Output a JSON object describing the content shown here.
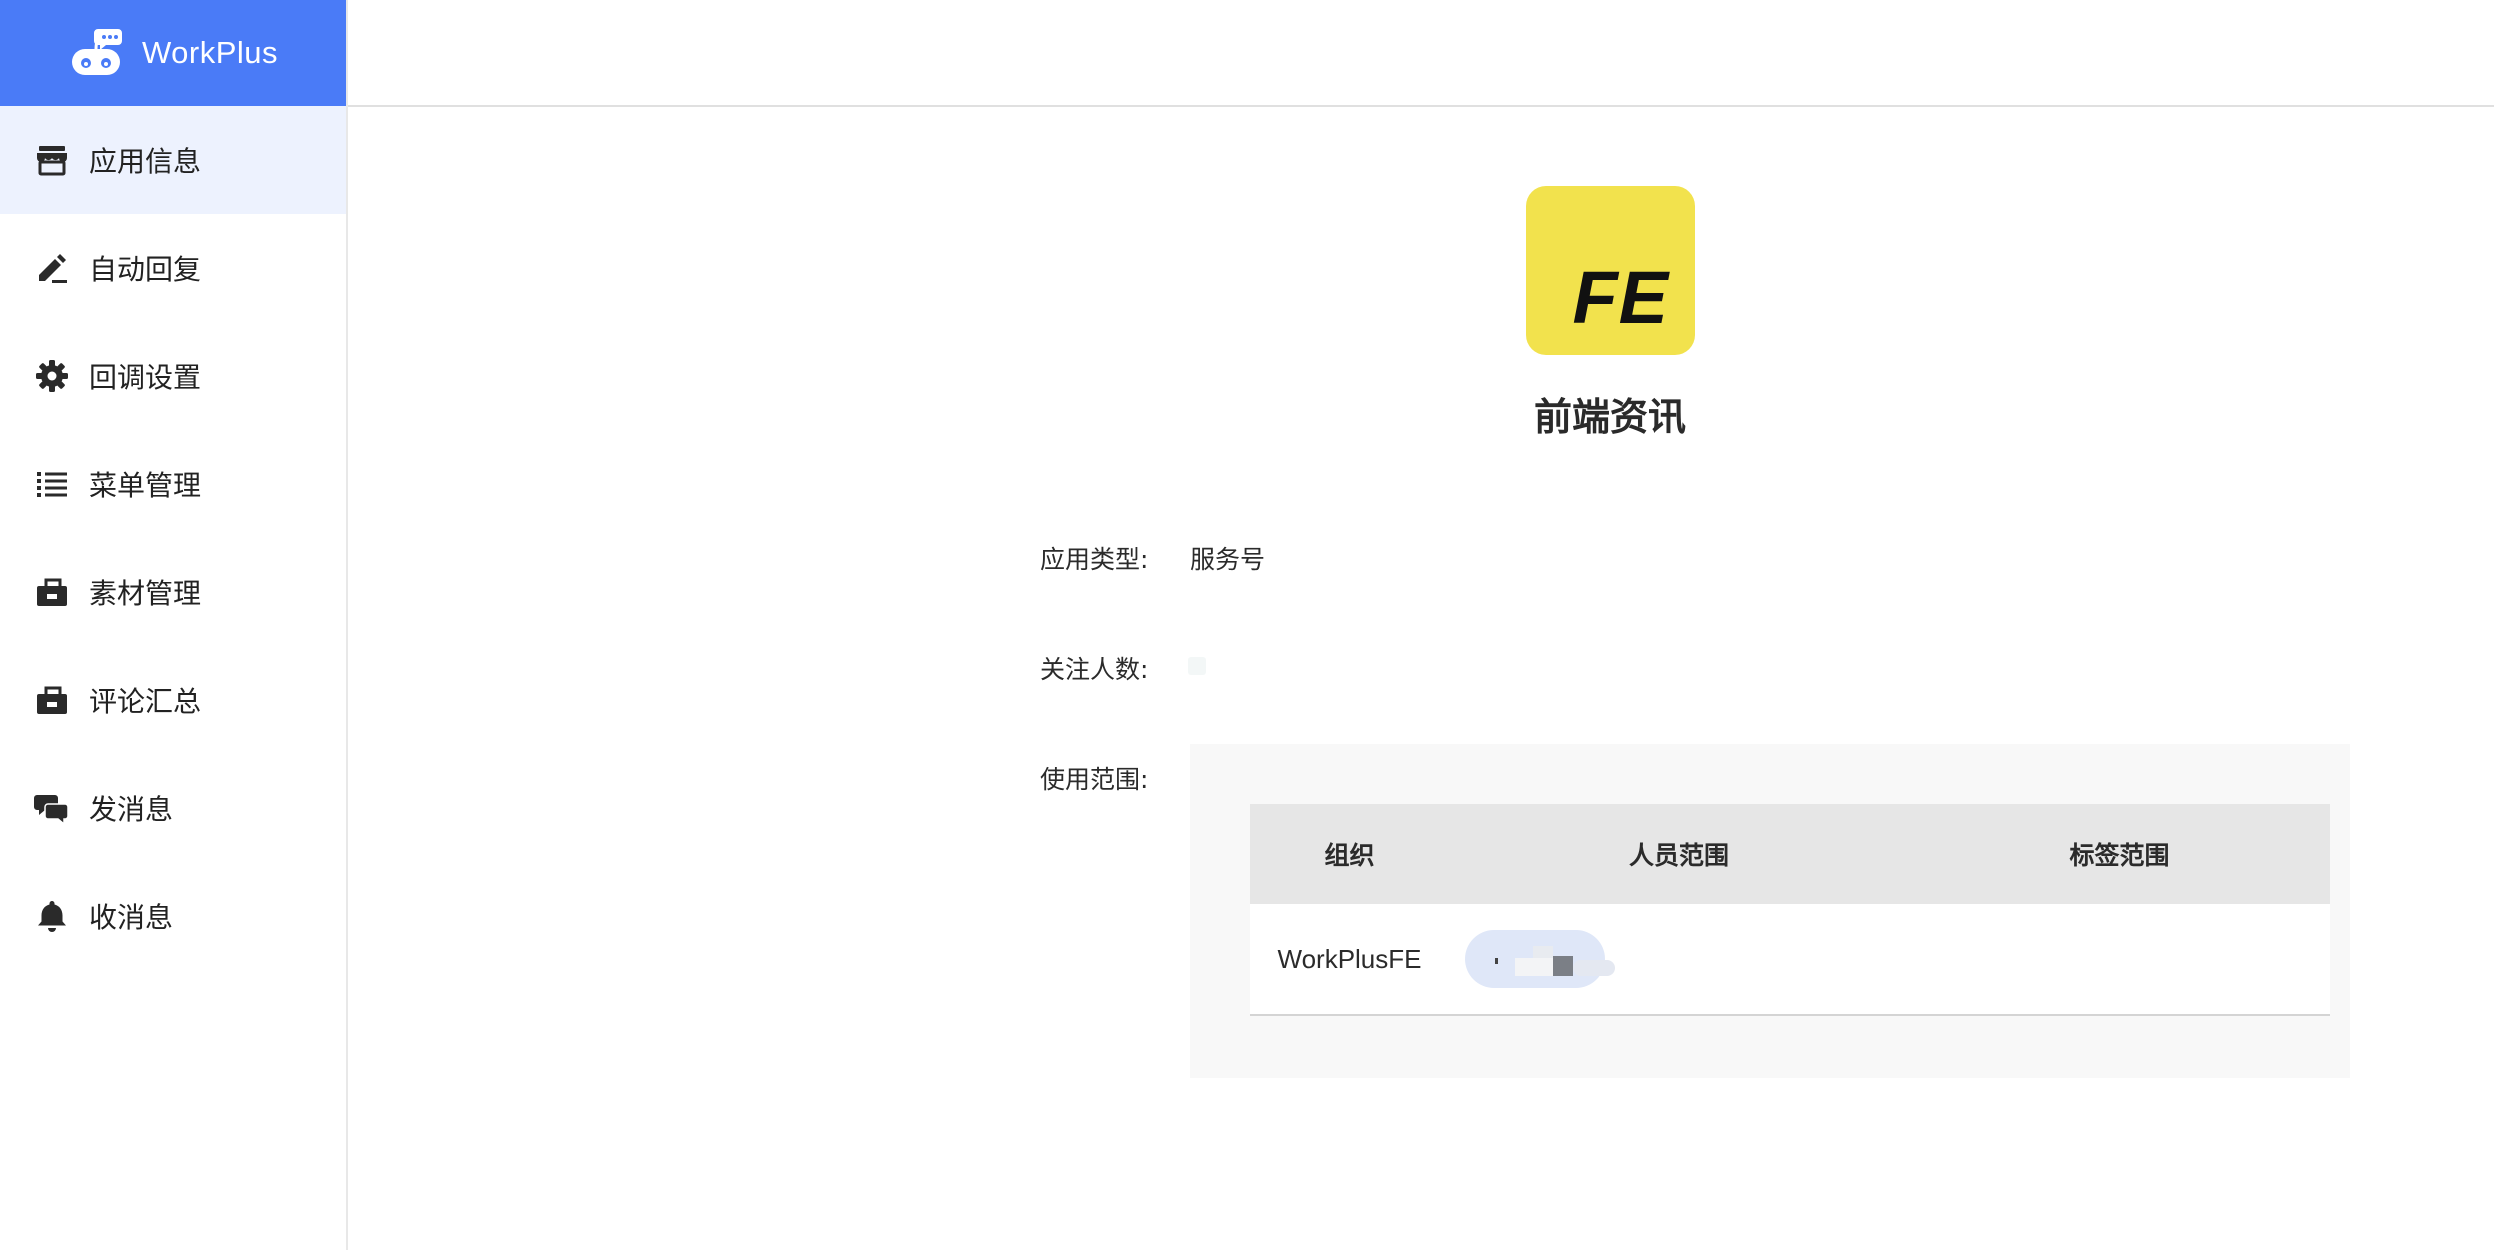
{
  "brand": {
    "name": "WorkPlus",
    "logo_icon": "robot-logo-icon",
    "color": "#4a7bf7"
  },
  "sidebar": {
    "items": [
      {
        "label": "应用信息",
        "icon": "store-icon",
        "active": true
      },
      {
        "label": "自动回复",
        "icon": "pen-icon",
        "active": false
      },
      {
        "label": "回调设置",
        "icon": "gear-icon",
        "active": false
      },
      {
        "label": "菜单管理",
        "icon": "list-icon",
        "active": false
      },
      {
        "label": "素材管理",
        "icon": "toolbox-icon",
        "active": false
      },
      {
        "label": "评论汇总",
        "icon": "toolbox-icon",
        "active": false
      },
      {
        "label": "发消息",
        "icon": "chat-bubbles-icon",
        "active": false
      },
      {
        "label": "收消息",
        "icon": "bell-icon",
        "active": false
      }
    ],
    "active_background": "#edf2fe"
  },
  "app": {
    "icon_text": "FE",
    "icon_color": "#f2e24d",
    "name": "前端资讯"
  },
  "info": {
    "type_label": "应用类型:",
    "type_value": "服务号",
    "followers_label": "关注人数:",
    "scope_label": "使用范围:"
  },
  "scope_table": {
    "headers": [
      "组织",
      "人员范围",
      "标签范围"
    ],
    "rows": [
      {
        "org": "WorkPlusFE",
        "tags": ""
      }
    ]
  }
}
